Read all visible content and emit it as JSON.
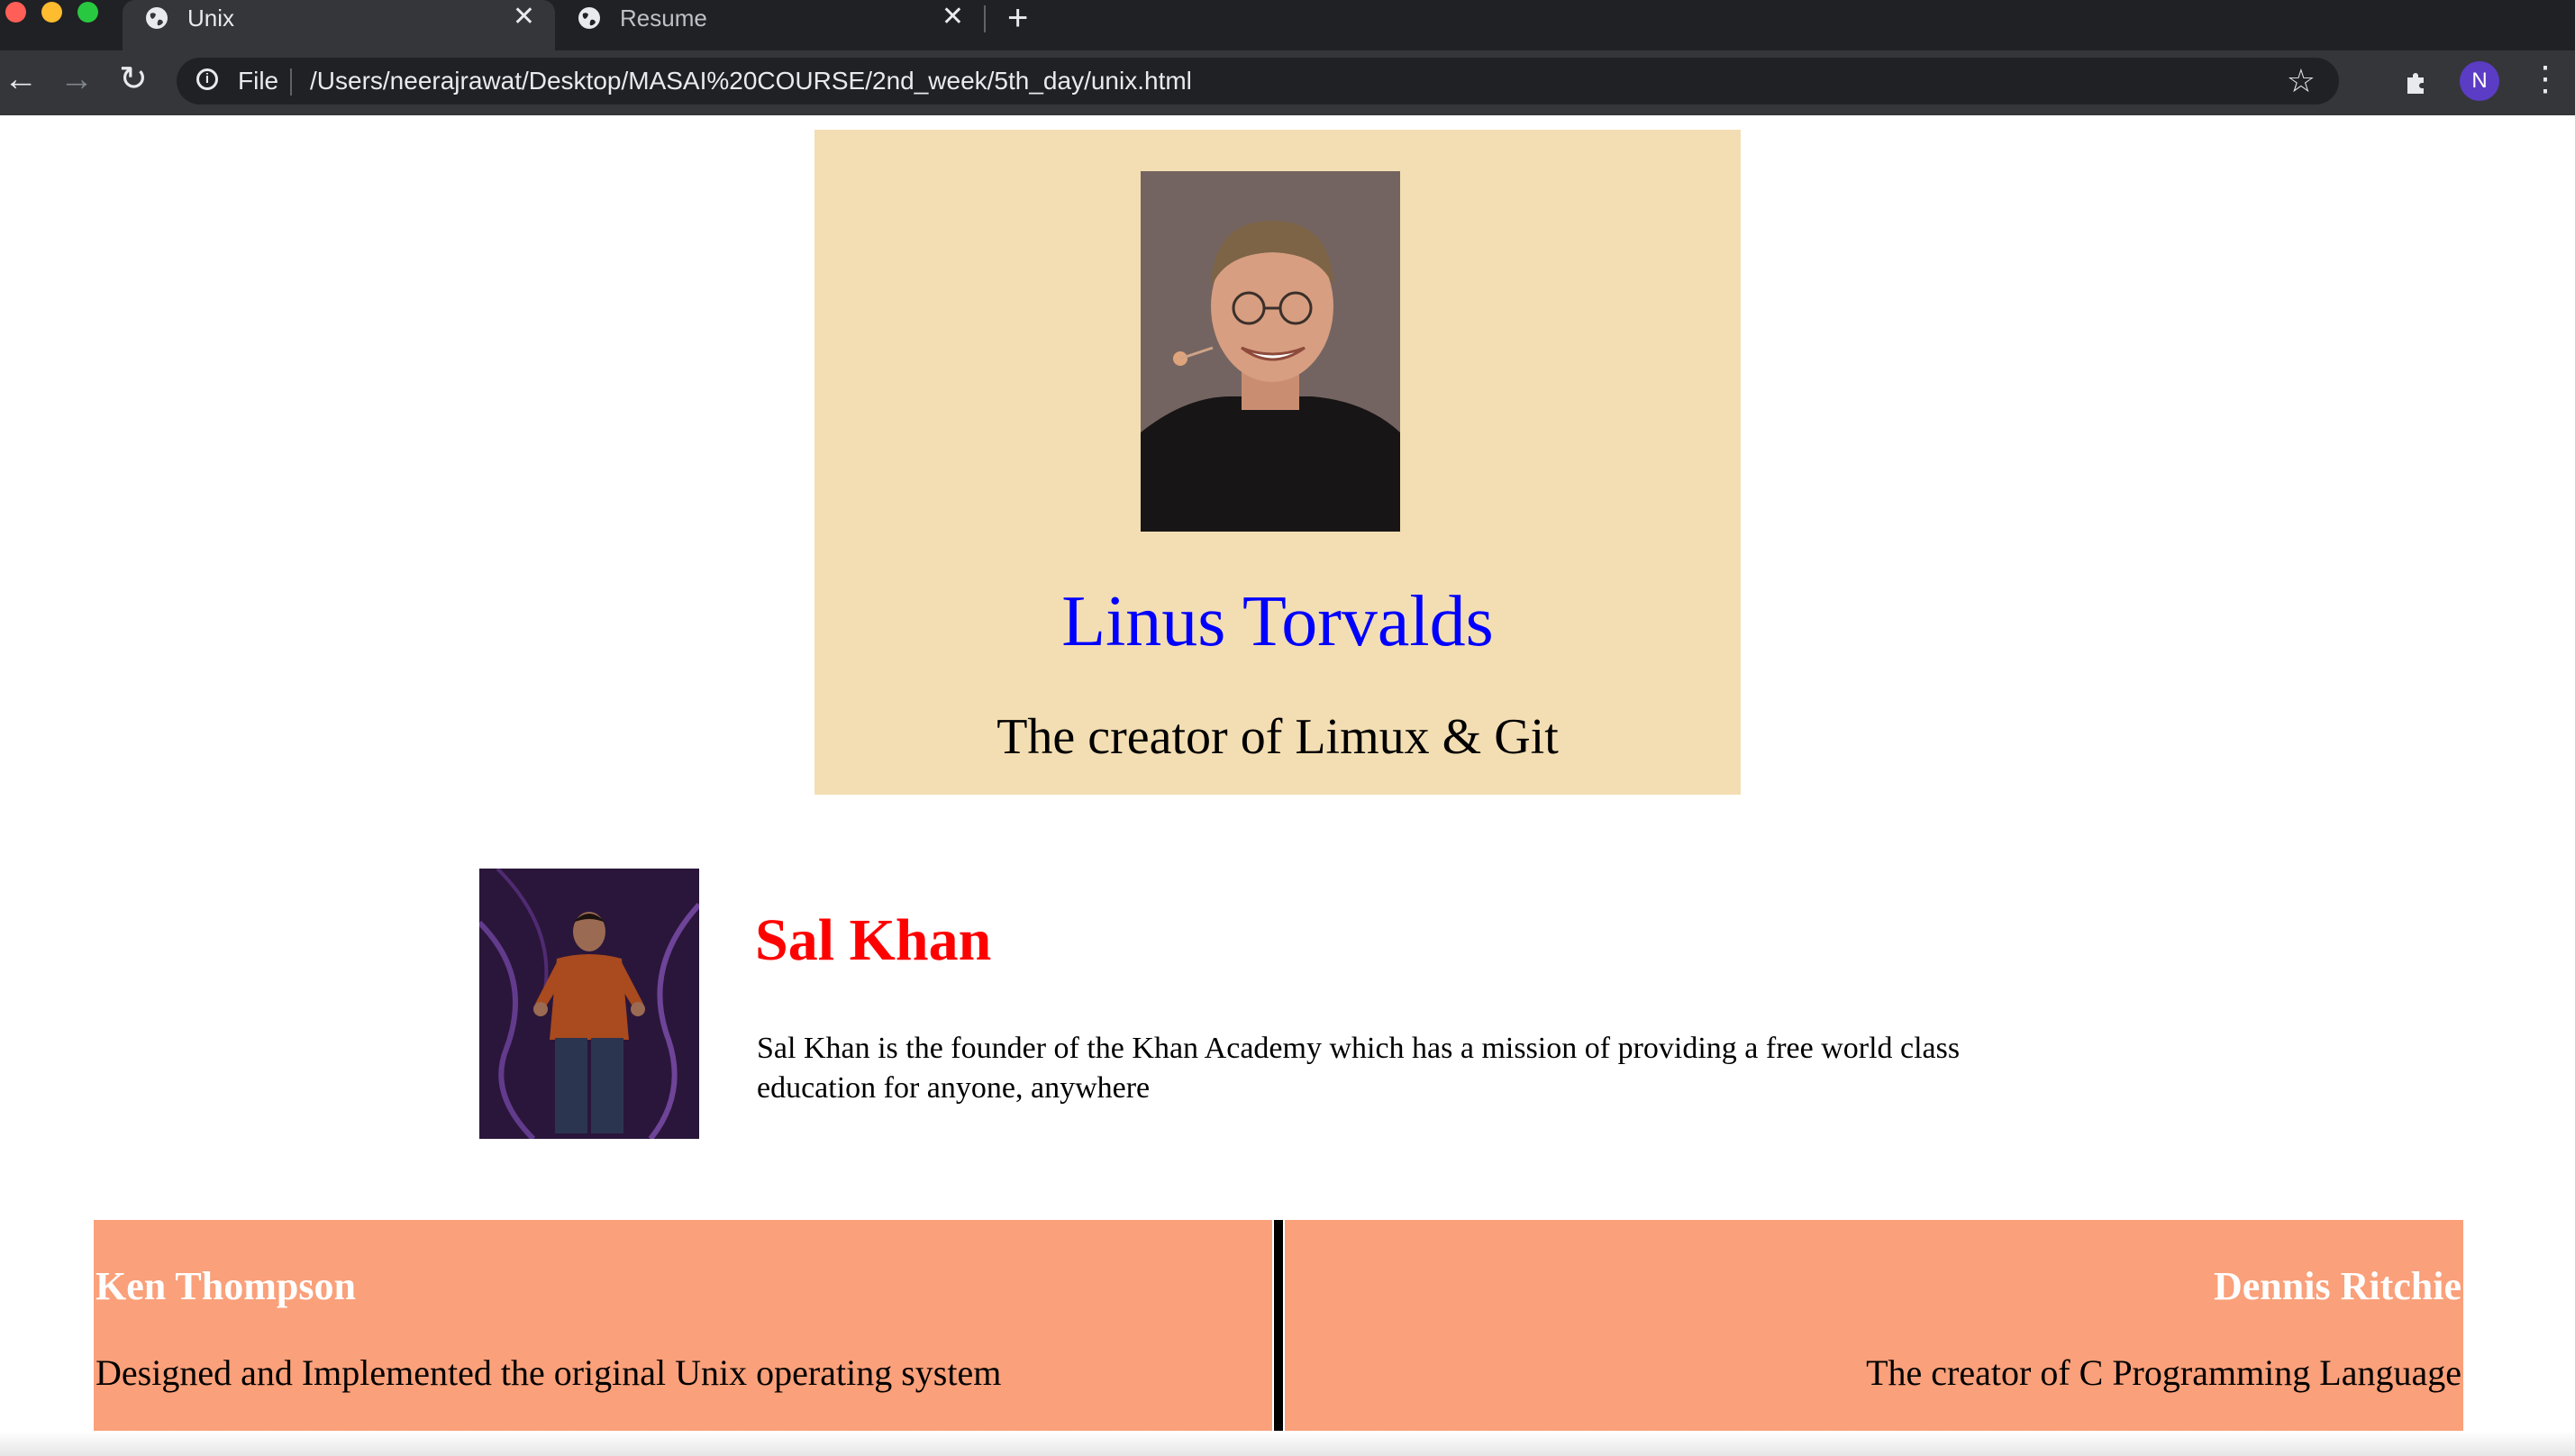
{
  "browser": {
    "tabs": [
      {
        "title": "Unix",
        "active": true,
        "icon": "globe-icon"
      },
      {
        "title": "Resume",
        "active": false,
        "icon": "globe-icon"
      }
    ],
    "new_tab_symbol": "+",
    "close_symbol": "✕",
    "address": {
      "scheme_label": "File",
      "url": "/Users/neerajrawat/Desktop/MASAI%20COURSE/2nd_week/5th_day/unix.html"
    },
    "profile_initial": "N",
    "colors": {
      "chrome_dark": "#202124",
      "chrome_toolbar": "#35363a",
      "avatar": "#5b3cc4"
    }
  },
  "page": {
    "featured": {
      "name": "Linus Torvalds",
      "description": "The creator of Limux & Git",
      "photo": "linus-torvalds-photo",
      "colors": {
        "background": "#f3deb3",
        "name": "#0000ff"
      }
    },
    "profile": {
      "name": "Sal Khan",
      "description": "Sal Khan is the founder of the Khan Academy which has a mission of providing a free world class education for anyone, anywhere",
      "photo": "sal-khan-photo",
      "colors": {
        "name": "#ff0000"
      }
    },
    "people": [
      {
        "name": "Ken Thompson",
        "description": "Designed and Implemented the original Unix operating system"
      },
      {
        "name": "Dennis Ritchie",
        "description": "The creator of C Programming Language"
      }
    ],
    "people_colors": {
      "card": "#faa07a",
      "name": "#ffffff",
      "divider": "#000000"
    }
  }
}
